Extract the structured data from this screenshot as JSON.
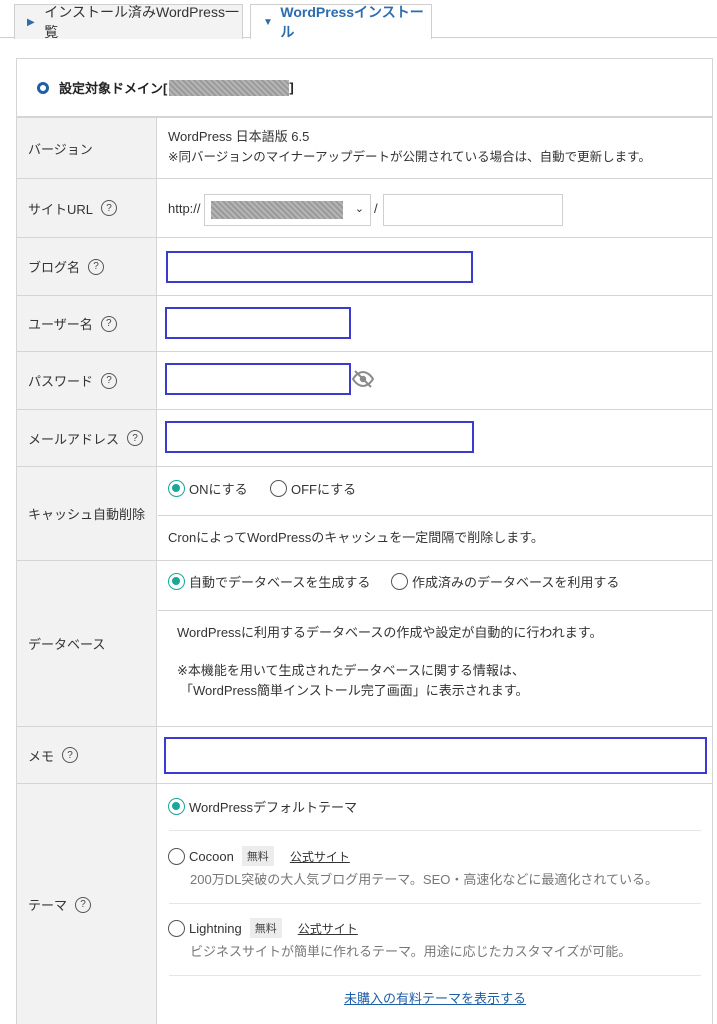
{
  "tabs": [
    {
      "label": "インストール済みWordPress一覧"
    },
    {
      "label": "WordPressインストール"
    }
  ],
  "domain": {
    "label": "設定対象ドメイン["
  },
  "fields": {
    "version": {
      "label": "バージョン",
      "value": "WordPress 日本語版 6.5",
      "note": "※同バージョンのマイナーアップデートが公開されている場合は、自動で更新します。"
    },
    "site_url": {
      "label": "サイトURL",
      "help": "?",
      "prefix": "http://",
      "slash": "/"
    },
    "blog_name": {
      "label": "ブログ名",
      "help": "?"
    },
    "user_name": {
      "label": "ユーザー名",
      "help": "?"
    },
    "password": {
      "label": "パスワード",
      "help": "?"
    },
    "email": {
      "label": "メールアドレス",
      "help": "?"
    },
    "cache": {
      "label": "キャッシュ自動削除",
      "on_label": "ONにする",
      "off_label": "OFFにする",
      "desc": "CronによってWordPressのキャッシュを一定間隔で削除します。"
    },
    "database": {
      "label": "データベース",
      "auto_label": "自動でデータベースを生成する",
      "existing_label": "作成済みのデータベースを利用する",
      "desc1": "WordPressに利用するデータベースの作成や設定が自動的に行われます。",
      "desc2": "※本機能を用いて生成されたデータベースに関する情報は、",
      "desc3": "「WordPress簡単インストール完了画面」に表示されます。"
    },
    "memo": {
      "label": "メモ",
      "help": "?"
    },
    "theme": {
      "label": "テーマ",
      "help": "?",
      "default_label": "WordPressデフォルトテーマ",
      "cocoon": {
        "name": "Cocoon",
        "badge": "無料",
        "link": "公式サイト",
        "desc": "200万DL突破の大人気ブログ用テーマ。SEO・高速化などに最適化されている。"
      },
      "lightning": {
        "name": "Lightning",
        "badge": "無料",
        "link": "公式サイト",
        "desc": "ビジネスサイトが簡単に作れるテーマ。用途に応じたカスタマイズが可能。"
      },
      "paid_link": "未購入の有料テーマを表示する"
    }
  }
}
